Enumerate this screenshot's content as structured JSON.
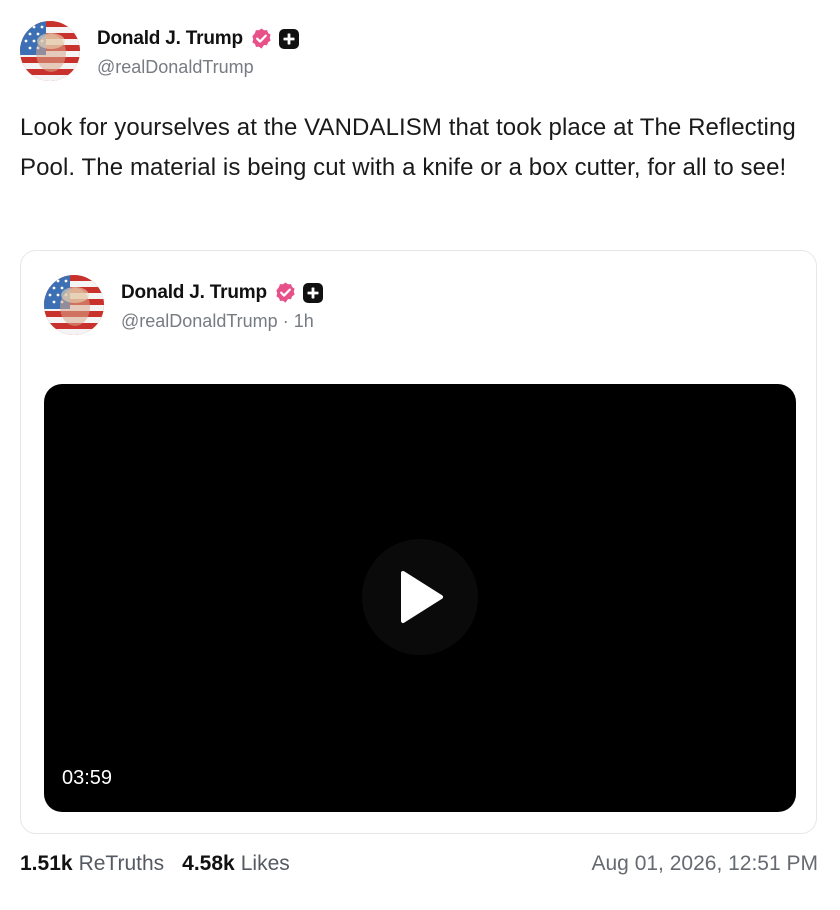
{
  "post": {
    "author": {
      "display_name": "Donald J. Trump",
      "handle": "@realDonaldTrump",
      "avatar_icon": "flag-portrait-avatar",
      "verified_icon": "verified-badge-icon",
      "verified_color": "#e8508a",
      "extra_icon": "plus-badge-icon"
    },
    "text": "Look for yourselves at the VANDALISM that took place at The Reflecting Pool. The material is being cut with a knife or a box cutter, for all to see!",
    "quoted": {
      "author": {
        "display_name": "Donald J. Trump",
        "handle": "@realDonaldTrump",
        "separator": "·",
        "time_ago": "1h"
      },
      "video": {
        "duration": "03:59",
        "play_icon": "play-icon"
      }
    },
    "stats": {
      "retruths_count": "1.51k",
      "retruths_label": "ReTruths",
      "likes_count": "4.58k",
      "likes_label": "Likes"
    },
    "timestamp": "Aug 01, 2026, 12:51 PM"
  }
}
